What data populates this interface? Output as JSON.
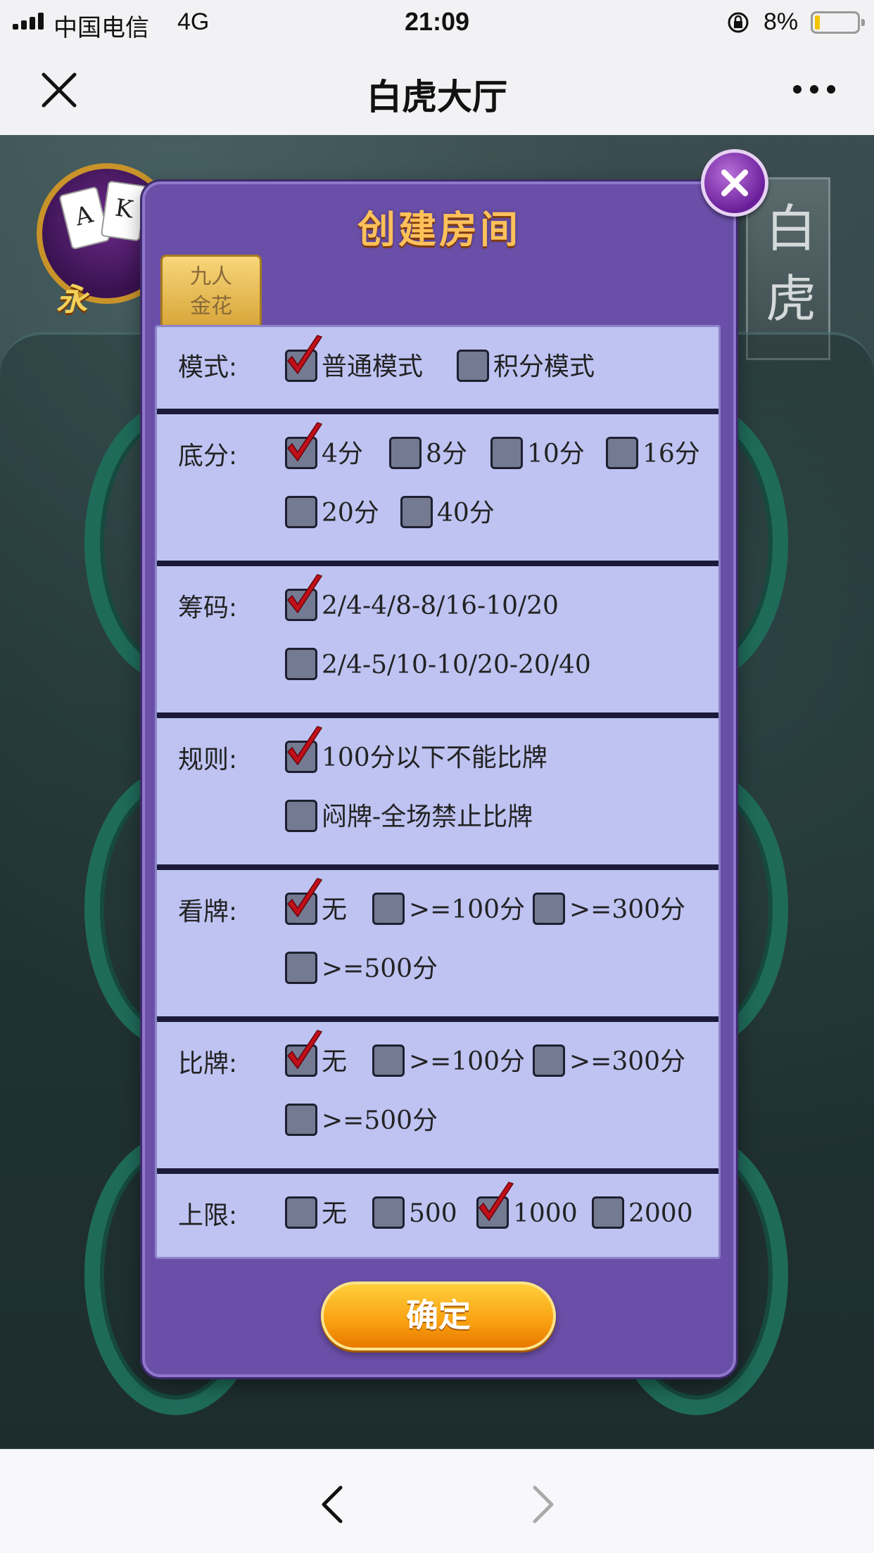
{
  "status_bar": {
    "carrier": "中国电信",
    "network": "4G",
    "time": "21:09",
    "battery": "8%",
    "battery_level": 0.08
  },
  "nav": {
    "title": "白虎大厅"
  },
  "background": {
    "logo_text": "永",
    "banner_text": "白虎",
    "cards": [
      "A",
      "K"
    ]
  },
  "dialog": {
    "title": "创建房间",
    "tab_label_line1": "九人",
    "tab_label_line2": "金花",
    "confirm_label": "确定",
    "sections": {
      "mode": {
        "label": "模式:",
        "options": [
          {
            "text": "普通模式",
            "checked": true
          },
          {
            "text": "积分模式",
            "checked": false
          }
        ]
      },
      "base": {
        "label": "底分:",
        "options": [
          {
            "text": "4分",
            "checked": true
          },
          {
            "text": "8分",
            "checked": false
          },
          {
            "text": "10分",
            "checked": false
          },
          {
            "text": "16分",
            "checked": false
          },
          {
            "text": "20分",
            "checked": false
          },
          {
            "text": "40分",
            "checked": false
          }
        ]
      },
      "chips": {
        "label": "筹码:",
        "options": [
          {
            "text": "2/4-4/8-8/16-10/20",
            "checked": true
          },
          {
            "text": "2/4-5/10-10/20-20/40",
            "checked": false
          }
        ]
      },
      "rules": {
        "label": "规则:",
        "options": [
          {
            "text": "100分以下不能比牌",
            "checked": true
          },
          {
            "text": "闷牌-全场禁止比牌",
            "checked": false
          }
        ]
      },
      "look": {
        "label": "看牌:",
        "options": [
          {
            "text": "无",
            "checked": true
          },
          {
            "text": ">=100分",
            "checked": false
          },
          {
            "text": ">=300分",
            "checked": false
          },
          {
            "text": ">=500分",
            "checked": false
          }
        ]
      },
      "compare": {
        "label": "比牌:",
        "options": [
          {
            "text": "无",
            "checked": true
          },
          {
            "text": ">=100分",
            "checked": false
          },
          {
            "text": ">=300分",
            "checked": false
          },
          {
            "text": ">=500分",
            "checked": false
          }
        ]
      },
      "limit": {
        "label": "上限:",
        "options": [
          {
            "text": "无",
            "checked": false
          },
          {
            "text": "500",
            "checked": false
          },
          {
            "text": "1000",
            "checked": true
          },
          {
            "text": "2000",
            "checked": false
          }
        ]
      }
    }
  },
  "colors": {
    "dialog_bg": "#6a4fa8",
    "content_bg": "#bec3f2",
    "title_gold": "#ffc15a",
    "tick_red": "#c0101a",
    "confirm_orange": "#f9a010"
  }
}
